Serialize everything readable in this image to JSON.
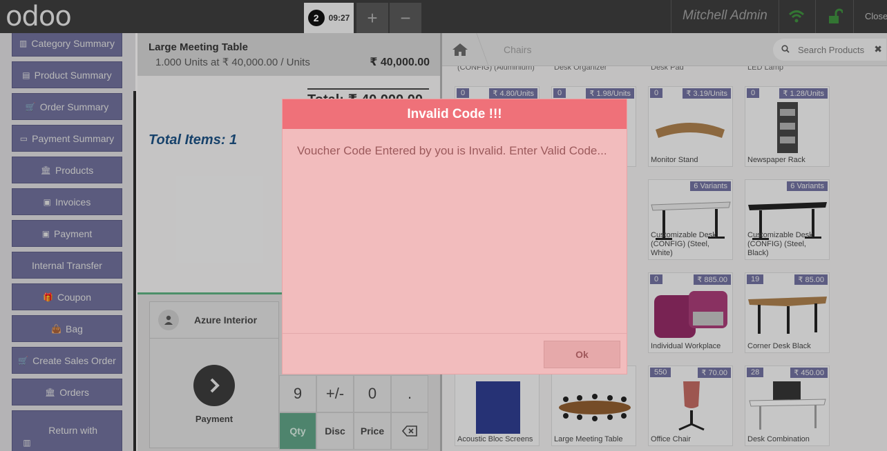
{
  "topbar": {
    "logo": "odoo",
    "order_number": "2",
    "order_time": "09:27",
    "add_label": "+",
    "remove_label": "−",
    "user_name": "Mitchell Admin",
    "close_label": "Close"
  },
  "sidebar": {
    "items": [
      {
        "label": "Category Summary",
        "icon": "bar-chart-icon",
        "glyph": "▥"
      },
      {
        "label": "Product Summary",
        "icon": "file-icon",
        "glyph": "▤"
      },
      {
        "label": "Order Summary",
        "icon": "cart-icon",
        "glyph": "🛒"
      },
      {
        "label": "Payment Summary",
        "icon": "credit-card-icon",
        "glyph": "▭"
      },
      {
        "label": "Products",
        "icon": "bank-icon",
        "glyph": "🏛"
      },
      {
        "label": "Invoices",
        "icon": "money-icon",
        "glyph": "▣"
      },
      {
        "label": "Payment",
        "icon": "money-icon",
        "glyph": "▣"
      },
      {
        "label": "Internal Transfer",
        "icon": "",
        "glyph": ""
      },
      {
        "label": "Coupon",
        "icon": "gift-icon",
        "glyph": "🎁"
      },
      {
        "label": "Bag",
        "icon": "shopping-bag-icon",
        "glyph": "👜"
      },
      {
        "label": "Create Sales Order",
        "icon": "cart-icon",
        "glyph": "🛒"
      },
      {
        "label": "Orders",
        "icon": "bank-icon",
        "glyph": "🏛"
      },
      {
        "label": "Return with Barcode",
        "icon": "barcode-icon",
        "glyph": "▥"
      }
    ]
  },
  "order": {
    "line_name": "Large Meeting Table",
    "line_detail": "1.000 Units at ₹ 40,000.00 / Units",
    "line_price": "₹ 40,000.00",
    "total": "Total: ₹ 40,000.00",
    "total_items": "Total Items: 1"
  },
  "controls": {
    "customer": "Azure Interior",
    "payment_label": "Payment",
    "keys": [
      "9",
      "+/-",
      "0",
      ".",
      "Qty",
      "Disc",
      "Price"
    ]
  },
  "products": {
    "breadcrumb": "Chairs",
    "search_placeholder": "Search Products",
    "partial_row": [
      "(CONFIG) (Aluminium)",
      "Desk Organizer",
      "Desk Pad",
      "LED Lamp"
    ],
    "cards": [
      {
        "qty": "0",
        "price": "₹ 4.80/Units",
        "name": ""
      },
      {
        "qty": "0",
        "price": "₹ 1.98/Units",
        "name": ""
      },
      {
        "qty": "0",
        "price": "₹ 3.19/Units",
        "name": "Monitor Stand"
      },
      {
        "qty": "0",
        "price": "₹ 1.28/Units",
        "name": "Newspaper Rack"
      },
      {
        "qty": "",
        "price": "6 Variants",
        "name": "Customizable Desk (CONFIG) (Steel, White)"
      },
      {
        "qty": "",
        "price": "6 Variants",
        "name": "Customizable Desk (CONFIG) (Steel, Black)"
      },
      {
        "qty": "0",
        "price": "₹ 885.00",
        "name": "Individual Workplace"
      },
      {
        "qty": "19",
        "price": "₹ 85.00",
        "name": "Corner Desk Black"
      },
      {
        "qty": "",
        "price": "",
        "name": "Acoustic Bloc Screens"
      },
      {
        "qty": "",
        "price": "",
        "name": "Large Meeting Table"
      },
      {
        "qty": "550",
        "price": "₹ 70.00",
        "name": "Office Chair"
      },
      {
        "qty": "28",
        "price": "₹ 450.00",
        "name": "Desk Combination"
      }
    ]
  },
  "dialog": {
    "title": "Invalid Code !!!",
    "message": "Voucher Code Entered by you is Invalid. Enter Valid Code...",
    "ok_label": "Ok"
  }
}
